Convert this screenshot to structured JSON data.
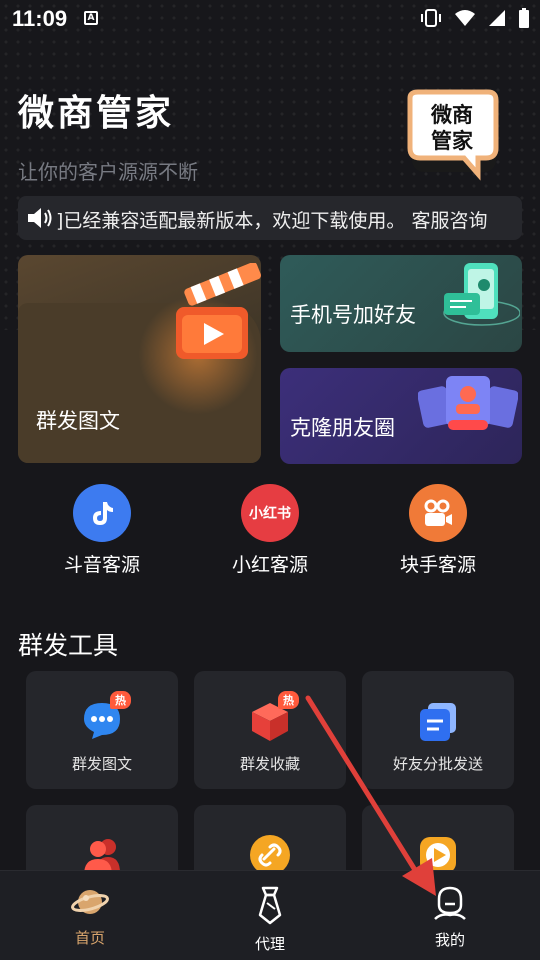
{
  "status_bar": {
    "time": "11:09",
    "a_icon": "A"
  },
  "header": {
    "title": "微商管家",
    "subtitle": "让你的客户源源不断",
    "logo_line1": "微商",
    "logo_line2": "管家"
  },
  "notice": {
    "text": "]已经兼容适配最新版本，欢迎下载使用。 客服咨询"
  },
  "cards": {
    "big_label": "群发图文",
    "phone_label": "手机号加好友",
    "clone_label": "克隆朋友圈"
  },
  "sources": [
    {
      "label": "斗音客源",
      "icon": "douyin-icon",
      "color": "#3d7bf0"
    },
    {
      "label": "小红客源",
      "icon": "xiaohongshu-icon",
      "color": "#e63d42",
      "icon_text": "小红书"
    },
    {
      "label": "块手客源",
      "icon": "kuaishou-icon",
      "color": "#f07a38"
    }
  ],
  "section": {
    "title": "群发工具"
  },
  "tools": [
    {
      "label": "群发图文",
      "badge": "热",
      "icon": "chat-bubble-icon"
    },
    {
      "label": "群发收藏",
      "badge": "热",
      "icon": "cube-icon"
    },
    {
      "label": "好友分批发送",
      "icon": "stacked-cards-icon"
    },
    {
      "label": "",
      "icon": "users-icon"
    },
    {
      "label": "",
      "icon": "link-icon"
    },
    {
      "label": "",
      "icon": "play-icon"
    }
  ],
  "tabbar": [
    {
      "label": "首页",
      "icon": "planet-icon",
      "active": true
    },
    {
      "label": "代理",
      "icon": "tie-icon"
    },
    {
      "label": "我的",
      "icon": "person-icon"
    }
  ],
  "colors": {
    "accent": "#d9a56d",
    "background": "#17171b",
    "arrow": "#e0403a"
  }
}
